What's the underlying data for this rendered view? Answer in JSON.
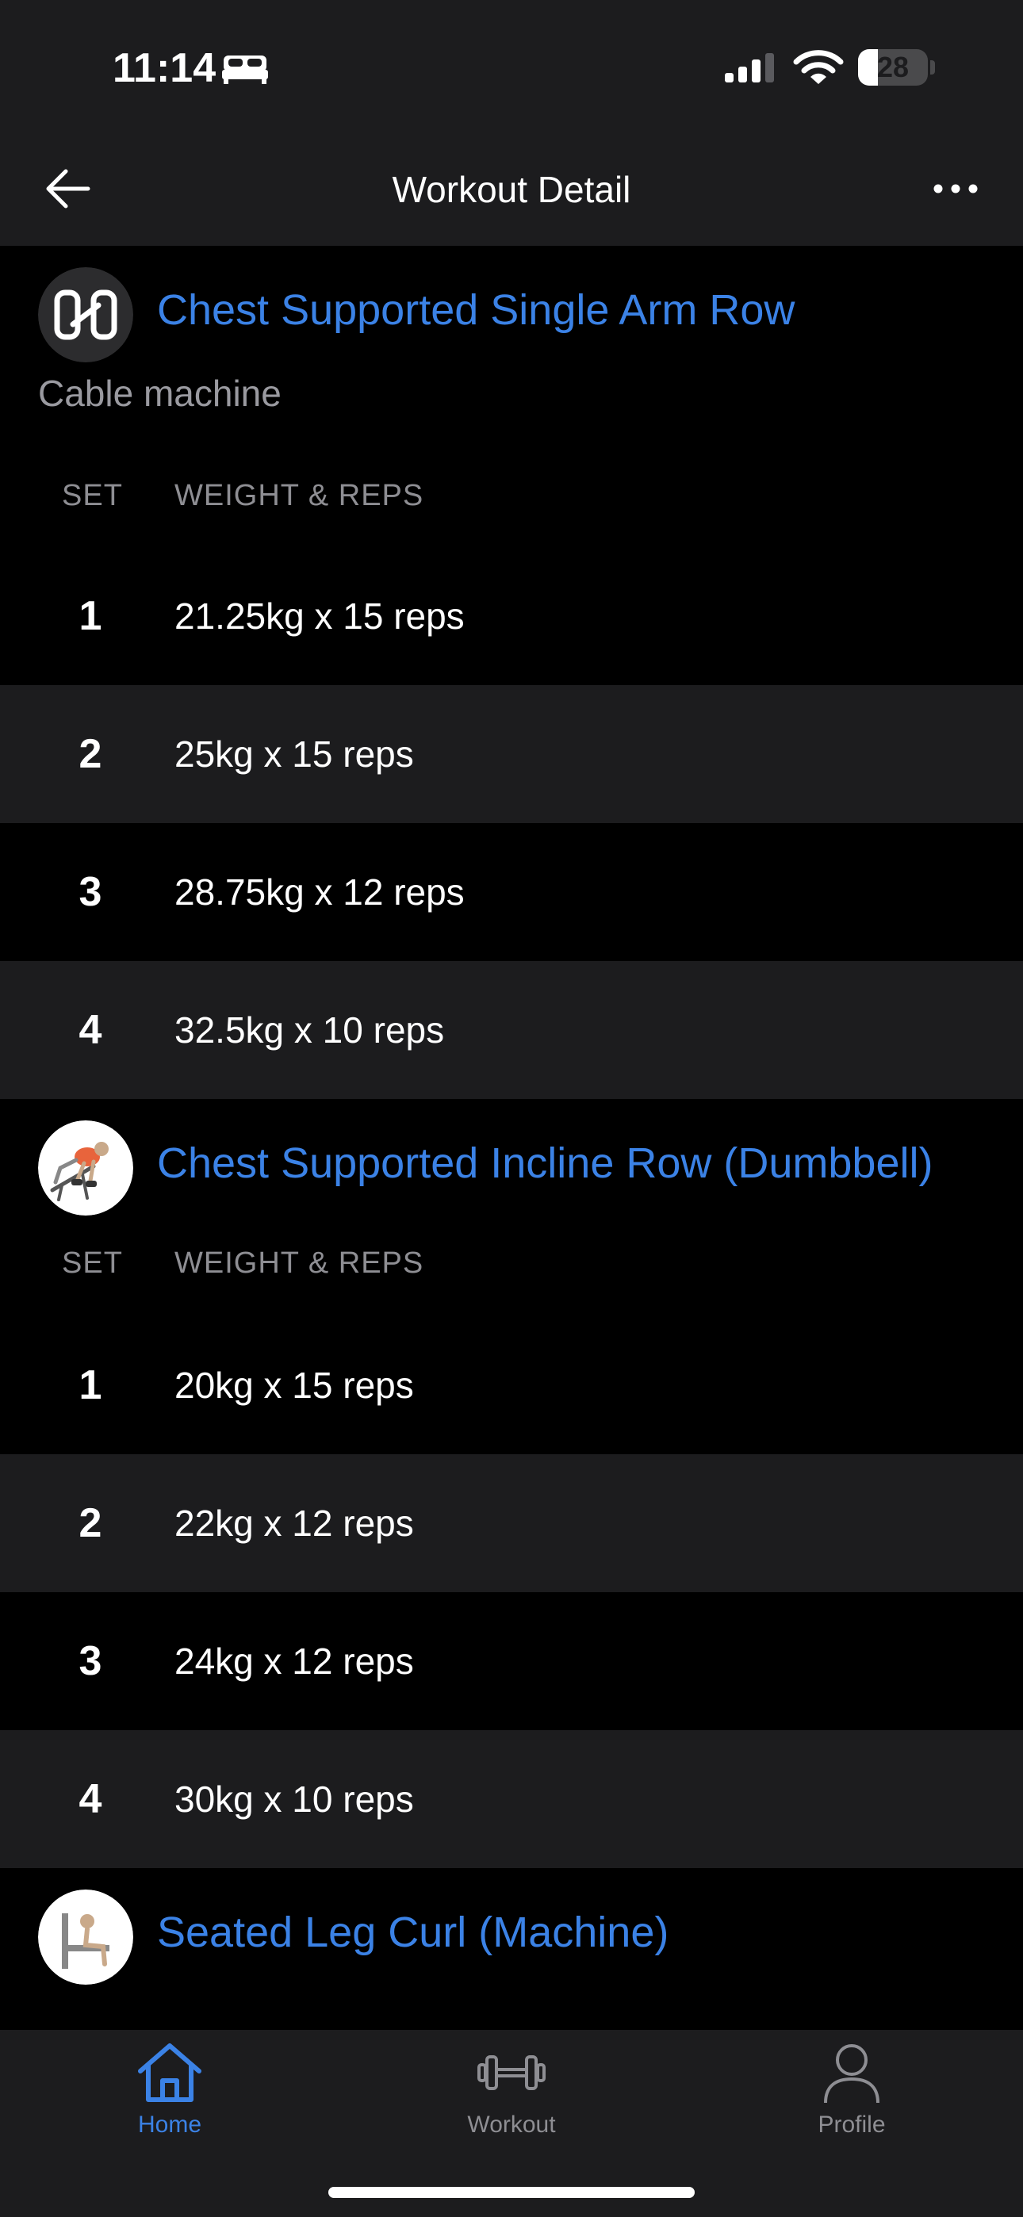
{
  "status_bar": {
    "time": "11:14",
    "battery_level": "28",
    "battery_fraction": 0.28,
    "icons": [
      "bed-icon",
      "cellular-signal-icon",
      "wifi-icon",
      "battery-icon"
    ]
  },
  "nav": {
    "title": "Workout Detail",
    "back_icon": "arrow-left-icon",
    "more_icon": "more-horizontal-icon"
  },
  "exercises": [
    {
      "title": "Chest Supported Single Arm Row",
      "equipment": "Cable machine",
      "thumb": "hevy-logo-icon",
      "set_header": "SET",
      "weight_header": "WEIGHT & REPS",
      "sets": [
        {
          "num": "1",
          "text": "21.25kg x 15 reps"
        },
        {
          "num": "2",
          "text": "25kg x 15 reps"
        },
        {
          "num": "3",
          "text": "28.75kg x 12 reps"
        },
        {
          "num": "4",
          "text": "32.5kg x 10 reps"
        }
      ]
    },
    {
      "title": "Chest Supported Incline Row (Dumbbell)",
      "thumb": "incline-row-illustration",
      "set_header": "SET",
      "weight_header": "WEIGHT & REPS",
      "sets": [
        {
          "num": "1",
          "text": "20kg x 15 reps"
        },
        {
          "num": "2",
          "text": "22kg x 12 reps"
        },
        {
          "num": "3",
          "text": "24kg x 12 reps"
        },
        {
          "num": "4",
          "text": "30kg x 10 reps"
        }
      ]
    },
    {
      "title": "Seated Leg Curl (Machine)",
      "thumb": "leg-curl-illustration"
    }
  ],
  "tab_bar": {
    "tabs": [
      {
        "label": "Home",
        "icon": "home-icon",
        "active": true
      },
      {
        "label": "Workout",
        "icon": "dumbbell-icon",
        "active": false
      },
      {
        "label": "Profile",
        "icon": "person-icon",
        "active": false
      }
    ]
  },
  "colors": {
    "accent": "#3b82e6",
    "background": "#000000",
    "surface": "#1c1c1e",
    "muted_text": "#8e8e93"
  }
}
